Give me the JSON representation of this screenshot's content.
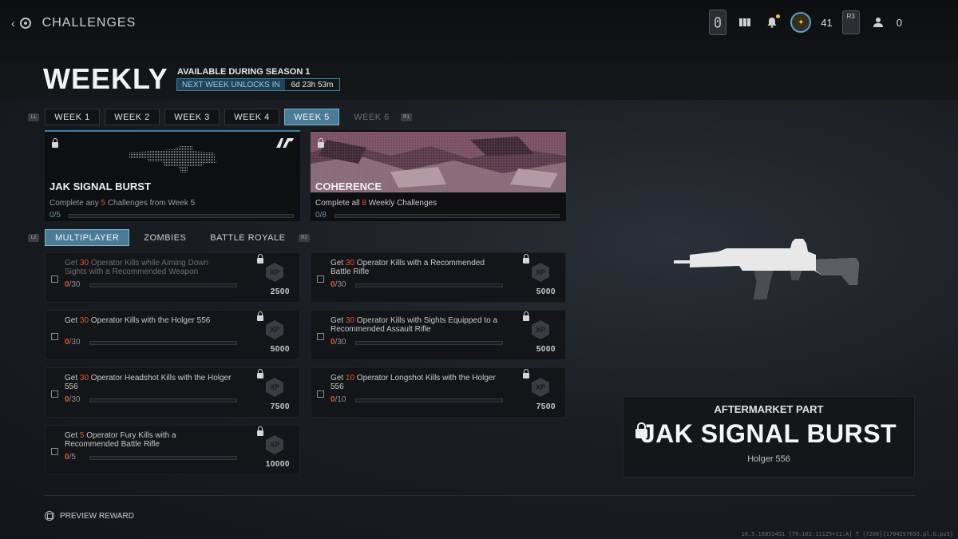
{
  "topbar": {
    "back_label": "CHALLENGES",
    "rank_level": "41",
    "r3_label": "R3",
    "party_count": "0"
  },
  "header": {
    "title": "WEEKLY",
    "availability": "AVAILABLE DURING SEASON 1",
    "unlock_label": "NEXT WEEK UNLOCKS IN",
    "unlock_time": "6d 23h 53m"
  },
  "hints": {
    "l1": "L1",
    "r1": "R1",
    "l2": "L2",
    "r2": "R2"
  },
  "week_tabs": [
    {
      "label": "WEEK 1",
      "state": "normal"
    },
    {
      "label": "WEEK 2",
      "state": "normal"
    },
    {
      "label": "WEEK 3",
      "state": "normal"
    },
    {
      "label": "WEEK 4",
      "state": "normal"
    },
    {
      "label": "WEEK 5",
      "state": "active"
    },
    {
      "label": "WEEK 6",
      "state": "disabled"
    }
  ],
  "rewards": [
    {
      "title": "JAK SIGNAL BURST",
      "desc_prefix": "Complete any ",
      "desc_num": "5",
      "desc_suffix": " Challenges from Week 5",
      "progress_done": "0",
      "progress_total": "/5",
      "progress": 0
    },
    {
      "title": "COHERENCE",
      "desc_prefix": "Complete all ",
      "desc_num": "8",
      "desc_suffix": " Weekly Challenges",
      "progress_done": "0",
      "progress_total": "/8",
      "progress": 0
    }
  ],
  "mode_tabs": [
    {
      "label": "MULTIPLAYER",
      "active": true
    },
    {
      "label": "ZOMBIES",
      "active": false
    },
    {
      "label": "BATTLE ROYALE",
      "active": false
    }
  ],
  "challenges": [
    {
      "pre": "Get ",
      "num": "30",
      "post": " Operator Kills while Aiming Down Sights with a Recommended Weapon",
      "done": "0",
      "total": "/30",
      "xp_icon": "XP",
      "xp": "2500",
      "dim": true,
      "progress": 0
    },
    {
      "pre": "Get ",
      "num": "30",
      "post": " Operator Kills with a Recommended Battle Rifle",
      "done": "0",
      "total": "/30",
      "xp_icon": "XP",
      "xp": "5000",
      "dim": false,
      "progress": 0
    },
    {
      "pre": "Get ",
      "num": "30",
      "post": " Operator Kills with the Holger 556",
      "done": "0",
      "total": "/30",
      "xp_icon": "XP",
      "xp": "5000",
      "dim": false,
      "progress": 0
    },
    {
      "pre": "Get ",
      "num": "30",
      "post": " Operator Kills with Sights Equipped to a Recommended Assault Rifle",
      "done": "0",
      "total": "/30",
      "xp_icon": "XP",
      "xp": "5000",
      "dim": false,
      "progress": 0
    },
    {
      "pre": "Get ",
      "num": "30",
      "post": " Operator Headshot Kills with the Holger 556",
      "done": "0",
      "total": "/30",
      "xp_icon": "XP",
      "xp": "7500",
      "dim": false,
      "progress": 0
    },
    {
      "pre": "Get ",
      "num": "10",
      "post": " Operator Longshot Kills with the Holger 556",
      "done": "0",
      "total": "/10",
      "xp_icon": "XP",
      "xp": "7500",
      "dim": false,
      "progress": 0
    },
    {
      "pre": "Get ",
      "num": "5",
      "post": " Operator Fury Kills with a Recommended Battle Rifle",
      "done": "0",
      "total": "/5",
      "xp_icon": "XP",
      "xp": "10000",
      "dim": false,
      "progress": 0
    }
  ],
  "reward_detail": {
    "category": "AFTERMARKET PART",
    "name": "JAK SIGNAL BURST",
    "weapon": "Holger 556"
  },
  "footer": {
    "preview_label": "PREVIEW REWARD",
    "build": "10.5.16853451 [79:102:11125+11:A] T [7200][1704297693.pl.G.ps5]"
  },
  "colors": {
    "accent": "#4a7b96",
    "highlight": "#e0572e"
  }
}
